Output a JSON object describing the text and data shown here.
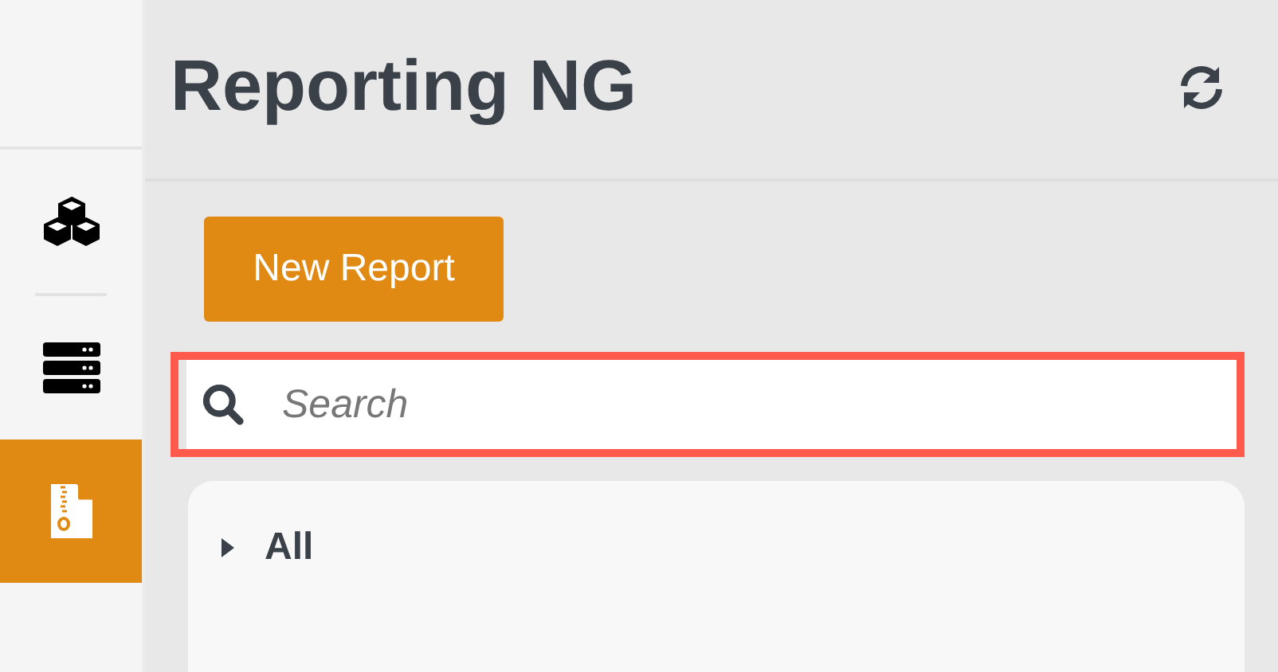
{
  "sidebar": {
    "items": [
      {
        "kind": "cubes",
        "selected": false
      },
      {
        "kind": "divider"
      },
      {
        "kind": "servers",
        "selected": false
      },
      {
        "kind": "zip-file",
        "selected": true
      }
    ]
  },
  "header": {
    "title": "Reporting NG"
  },
  "new_report_button": {
    "label": "New Report"
  },
  "search": {
    "placeholder": "Search"
  },
  "tree": {
    "items": [
      {
        "label": "All",
        "expanded": false
      }
    ]
  }
}
